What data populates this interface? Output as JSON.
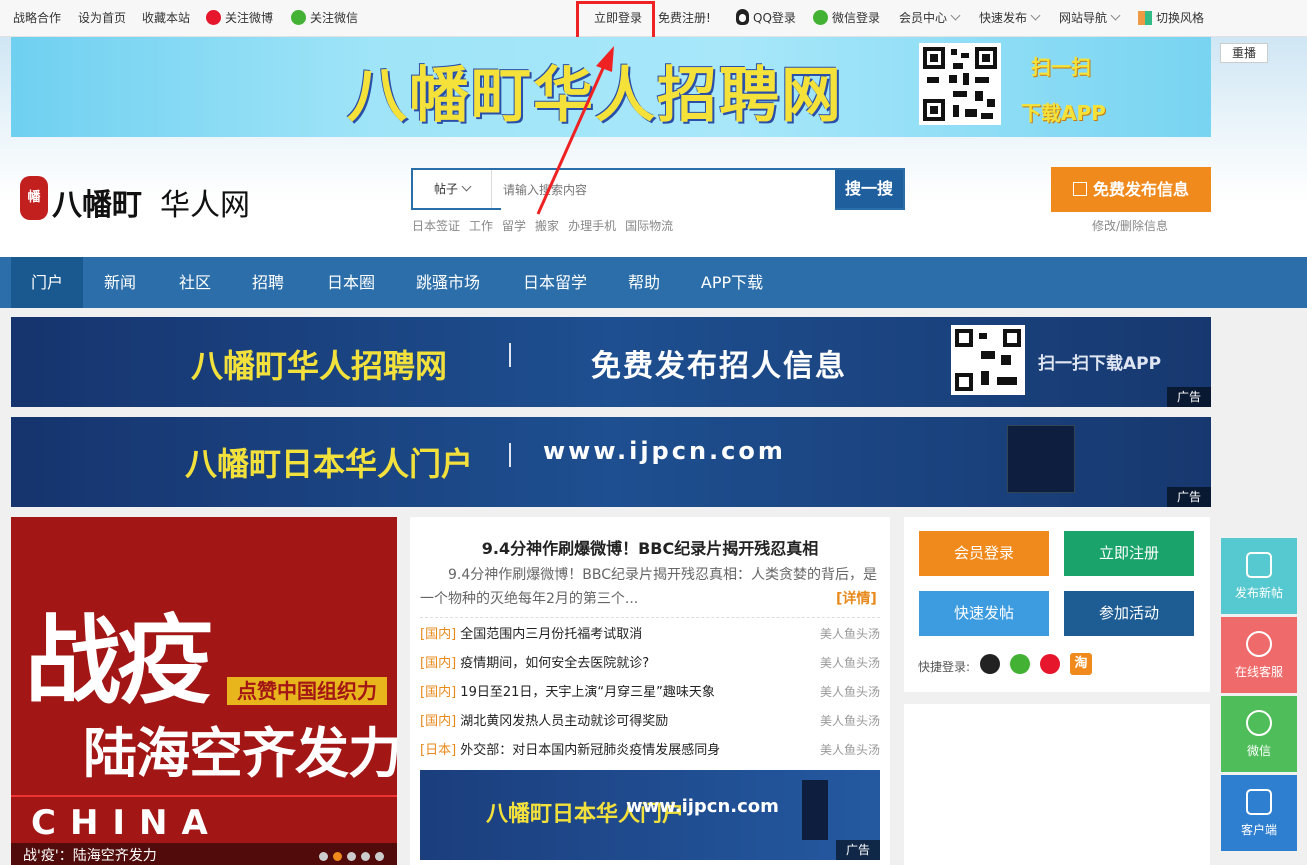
{
  "topbar": {
    "left_links": [
      "战略合作",
      "设为首页",
      "收藏本站",
      "关注微博",
      "关注微信"
    ],
    "login": "立即登录",
    "register": "免费注册!",
    "qq_login": "QQ登录",
    "wechat_login": "微信登录",
    "member_center": "会员中心",
    "quick_publish": "快速发布",
    "site_nav": "网站导航",
    "switch_style": "切换风格"
  },
  "banner": {
    "title": "八幡町华人招聘网",
    "scan": "扫一扫",
    "download": "下载APP",
    "replay": "重播"
  },
  "logo": {
    "seal": "幡",
    "name": "八幡町",
    "suffix": "华人网"
  },
  "search": {
    "type": "帖子",
    "placeholder": "请输入搜索内容",
    "button": "搜一搜",
    "hot": [
      "日本签证",
      "工作",
      "留学",
      "搬家",
      "办理手机",
      "国际物流"
    ]
  },
  "publish": {
    "button": "免费发布信息",
    "modify": "修改/删除信息"
  },
  "nav": [
    "门户",
    "新闻",
    "社区",
    "招聘",
    "日本圈",
    "跳骚市场",
    "日本留学",
    "帮助",
    "APP下载"
  ],
  "ads": [
    {
      "title": "八幡町华人招聘网",
      "slogan": "免费发布招人信息",
      "scan": "扫一扫下载APP",
      "tag": "广告"
    },
    {
      "title": "八幡町日本华人门户",
      "url": "www.ijpcn.com",
      "tag": "广告"
    }
  ],
  "poster": {
    "big": "战疫",
    "tag": "点赞中国组织力",
    "mid": "陆海空齐发力",
    "china": "CHINA",
    "caption": "战'疫'：陆海空齐发力"
  },
  "news": {
    "headline": "9.4分神作刷爆微博！BBC纪录片揭开残忍真相",
    "summary": "9.4分神作刷爆微博！BBC纪录片揭开残忍真相：人类贪婪的背后，是一个物种的灭绝每年2月的第三个...",
    "more": "[详情]",
    "items": [
      {
        "cat": "[国内]",
        "title": "全国范围内三月份托福考试取消",
        "src": "美人鱼头汤"
      },
      {
        "cat": "[国内]",
        "title": "疫情期间，如何安全去医院就诊?",
        "src": "美人鱼头汤"
      },
      {
        "cat": "[国内]",
        "title": "19日至21日，天宇上演“月穿三星”趣味天象",
        "src": "美人鱼头汤"
      },
      {
        "cat": "[国内]",
        "title": "湖北黄冈发热人员主动就诊可得奖励",
        "src": "美人鱼头汤"
      },
      {
        "cat": "[日本]",
        "title": "外交部：对日本国内新冠肺炎疫情发展感同身",
        "src": "美人鱼头汤"
      }
    ],
    "ad": {
      "title": "八幡町日本华人门户",
      "url": "www.ijpcn.com",
      "tag": "广告"
    }
  },
  "member": {
    "login": "会员登录",
    "register": "立即注册",
    "quick_post": "快速发帖",
    "join": "参加活动",
    "quick_login": "快捷登录:",
    "taobao": "淘"
  },
  "float": [
    "发布新帖",
    "在线客服",
    "微信",
    "客户端"
  ],
  "colors": {
    "nav": "#2b6ea9",
    "orange": "#f08a1c",
    "green": "#1aa36b",
    "blue": "#3d9be0",
    "darkblue": "#1e5c94",
    "highlight": "#e22222"
  }
}
